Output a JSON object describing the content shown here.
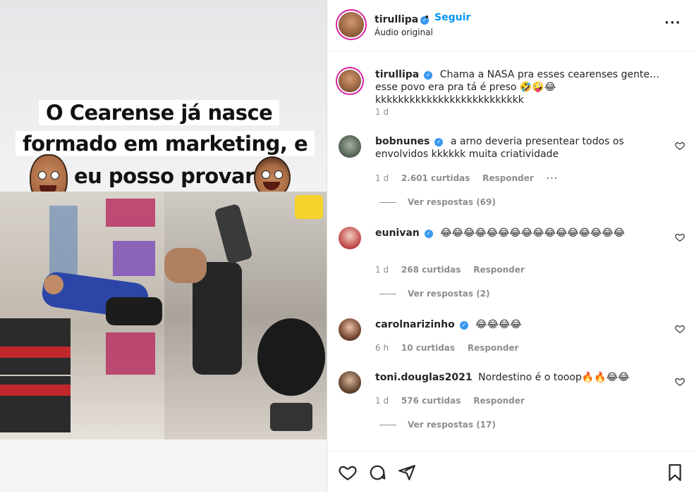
{
  "post_media": {
    "caption_line1": "O Cearense já nasce",
    "caption_line2": "formado em marketing, e",
    "caption_line3": "eu posso provar"
  },
  "header": {
    "username": "tirullipa",
    "separator": "•",
    "follow_label": "Seguir",
    "audio_label": "Áudio original",
    "more_label": "···"
  },
  "comments": [
    {
      "username": "tirullipa",
      "verified": true,
      "text": "Chama a NASA pra esses cearenses gente… esse povo era pra tá é preso 🤣🤪😂kkkkkkkkkkkkkkkkkkkkkkkkkk",
      "time": "1 d"
    },
    {
      "username": "bobnunes",
      "verified": true,
      "text": "a arno deveria presentear todos os envolvidos kkkkkk muita criatividade",
      "time": "1 d",
      "likes": "2.601 curtidas",
      "reply_label": "Responder",
      "more_label": "···",
      "view_replies": "Ver respostas (69)"
    },
    {
      "username": "eunivan",
      "verified": true,
      "text": "😂😂😂😂😂😂😂😂😂😂😂😂😂😂😂😂",
      "time": "1 d",
      "likes": "268 curtidas",
      "reply_label": "Responder",
      "view_replies": "Ver respostas (2)"
    },
    {
      "username": "carolnarizinho",
      "verified": true,
      "text": "😂😂😂😂",
      "time": "6 h",
      "likes": "10 curtidas",
      "reply_label": "Responder"
    },
    {
      "username": "toni.douglas2021",
      "verified": false,
      "text": "Nordestino é o tooop🔥🔥😂😂",
      "time": "1 d",
      "likes": "576 curtidas",
      "reply_label": "Responder",
      "view_replies": "Ver respostas (17)"
    }
  ],
  "footer_icons": [
    "heart-icon",
    "comment-icon",
    "share-icon",
    "bookmark-icon"
  ],
  "colors": {
    "follow_blue": "#0095f6",
    "verified_blue": "#3897f0",
    "meta_gray": "#8e8e8e"
  }
}
